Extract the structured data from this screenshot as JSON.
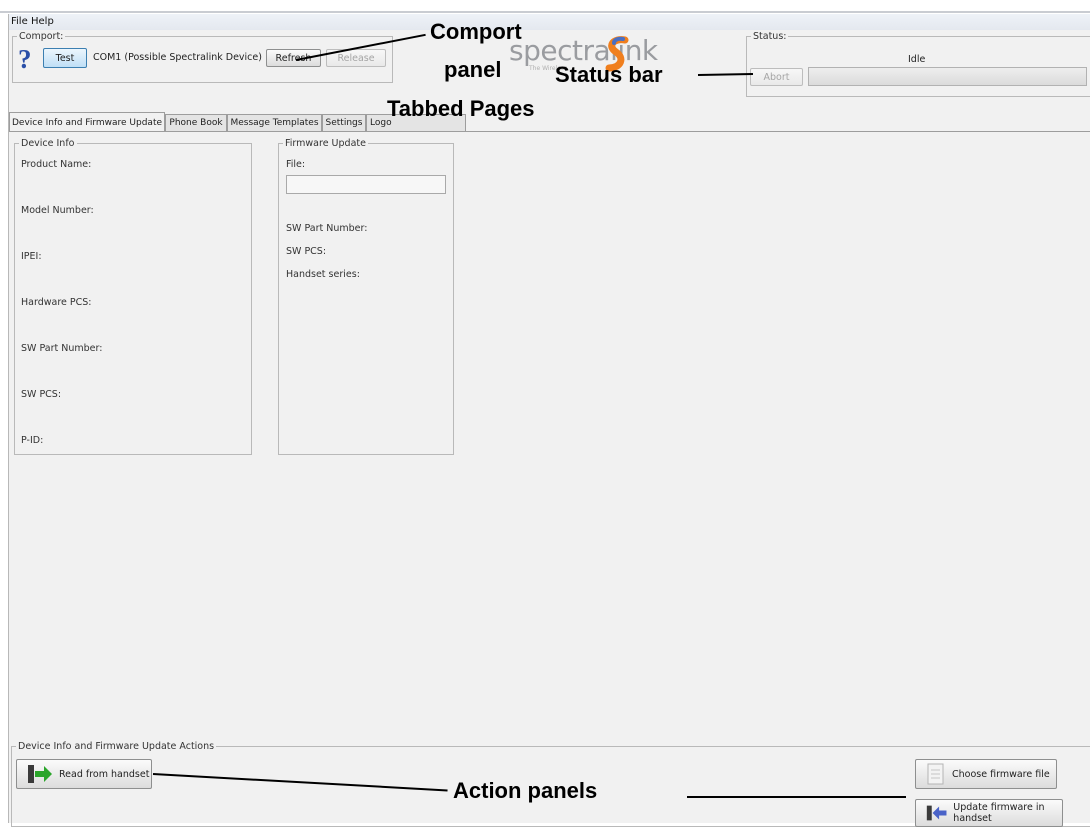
{
  "menu": {
    "file": "File",
    "help": "Help"
  },
  "comport": {
    "legend": "Comport:",
    "test_label": "Test",
    "port_value": "COM1 (Possible Spectralink Device)",
    "refresh_label": "Refresh",
    "release_label": "Release"
  },
  "logo": {
    "text": "spectralink",
    "tagline": "The Wireless..."
  },
  "status": {
    "legend": "Status:",
    "value": "Idle",
    "abort_label": "Abort"
  },
  "tabs": [
    {
      "label": "Device Info and Firmware Update"
    },
    {
      "label": "Phone Book"
    },
    {
      "label": "Message Templates"
    },
    {
      "label": "Settings"
    },
    {
      "label": "Logo"
    }
  ],
  "device_info": {
    "legend": "Device Info",
    "fields": [
      "Product Name:",
      "Model Number:",
      "IPEI:",
      "Hardware PCS:",
      "SW Part Number:",
      "SW PCS:",
      "P-ID:"
    ]
  },
  "firmware_update": {
    "legend": "Firmware Update",
    "file_label": "File:",
    "file_value": "",
    "fields": [
      "SW Part Number:",
      "SW PCS:",
      "Handset series:"
    ]
  },
  "actions": {
    "legend": "Device Info and Firmware Update Actions",
    "read_label": "Read from handset",
    "choose_label": "Choose firmware file",
    "update_label": "Update firmware in handset"
  },
  "annotations": {
    "comport_line1": "Comport",
    "comport_line2": "panel",
    "status_bar": "Status bar",
    "tabbed_pages": "Tabbed Pages",
    "action_panels": "Action panels"
  },
  "colors": {
    "accent_orange": "#f07f1e",
    "accent_blue": "#2a4fa8",
    "arrow_green": "#2aa52a"
  }
}
